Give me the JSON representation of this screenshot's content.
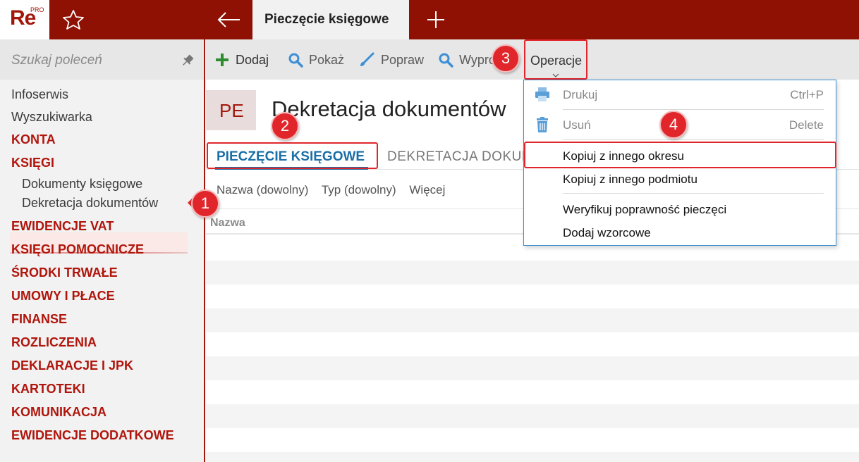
{
  "app": {
    "logo_text": "Re",
    "logo_sup": "PRO",
    "active_tab": "Pieczęcie księgowe"
  },
  "sidebar": {
    "search_placeholder": "Szukaj poleceń",
    "items": [
      {
        "label": "Infoserwis",
        "kind": "plain"
      },
      {
        "label": "Wyszukiwarka",
        "kind": "plain"
      },
      {
        "label": "KONTA",
        "kind": "section"
      },
      {
        "label": "KSIĘGI",
        "kind": "section"
      },
      {
        "label": "Dokumenty księgowe",
        "kind": "sub"
      },
      {
        "label": "Dekretacja dokumentów",
        "kind": "sub",
        "selected": true
      },
      {
        "label": "EWIDENCJE VAT",
        "kind": "section"
      },
      {
        "label": "KSIĘGI POMOCNICZE",
        "kind": "section"
      },
      {
        "label": "ŚRODKI TRWAŁE",
        "kind": "section"
      },
      {
        "label": "UMOWY I PŁACE",
        "kind": "section"
      },
      {
        "label": "FINANSE",
        "kind": "section"
      },
      {
        "label": "ROZLICZENIA",
        "kind": "section"
      },
      {
        "label": "DEKLARACJE I JPK",
        "kind": "section"
      },
      {
        "label": "KARTOTEKI",
        "kind": "section"
      },
      {
        "label": "KOMUNIKACJA",
        "kind": "section"
      },
      {
        "label": "EWIDENCJE DODATKOWE",
        "kind": "section"
      }
    ]
  },
  "toolbar": {
    "add": "Dodaj",
    "show": "Pokaż",
    "edit": "Popraw",
    "search_cut": "Wyprob",
    "operations": "Operacje"
  },
  "page": {
    "badge": "PE",
    "title": "Dekretacja dokumentów"
  },
  "subtabs": {
    "active": "PIECZĘCIE KSIĘGOWE",
    "second": "DEKRETACJA DOKUM"
  },
  "filters": {
    "name": "Nazwa (dowolny)",
    "type": "Typ (dowolny)",
    "more": "Więcej"
  },
  "table": {
    "col_name": "Nazwa"
  },
  "dropdown": {
    "print": "Drukuj",
    "print_shortcut": "Ctrl+P",
    "delete": "Usuń",
    "delete_shortcut": "Delete",
    "copy_period": "Kopiuj z innego okresu",
    "copy_entity": "Kopiuj z innego podmiotu",
    "verify": "Weryfikuj poprawność pieczęci",
    "add_templates": "Dodaj wzorcowe"
  },
  "annotations": {
    "n1": "1",
    "n2": "2",
    "n3": "3",
    "n4": "4"
  },
  "colors": {
    "brand": "#8e1104",
    "section_red": "#b0150c",
    "active_tab_blue": "#1a6fa6",
    "annotation_red": "#e0262b",
    "add_green": "#2e8b2e",
    "icon_blue": "#3d8fd6"
  }
}
